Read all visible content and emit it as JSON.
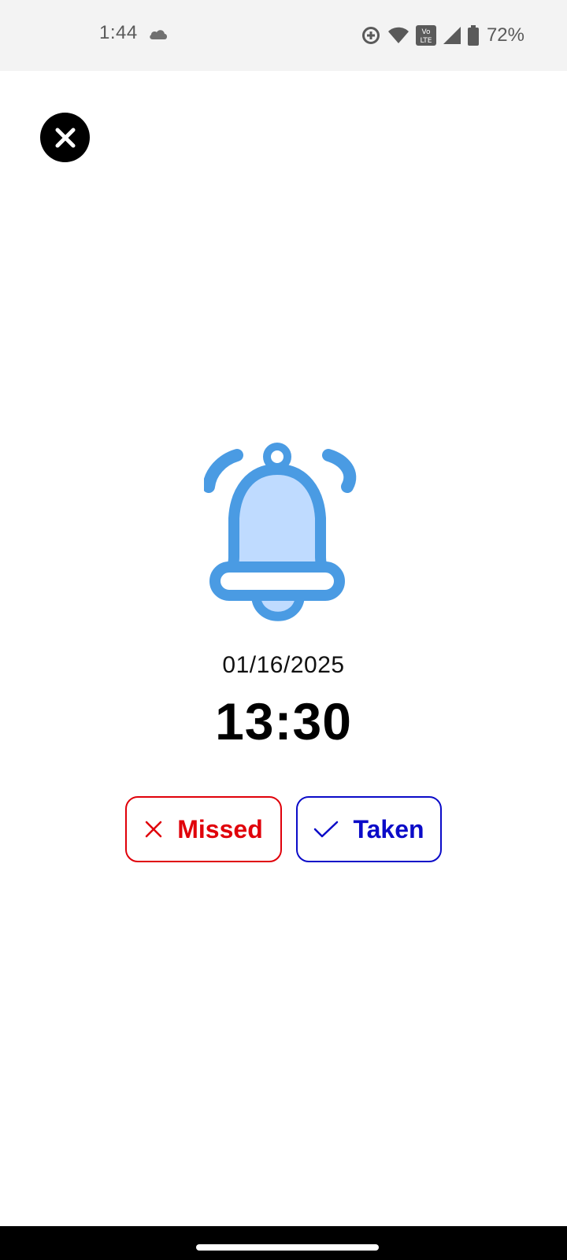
{
  "status_bar": {
    "time": "1:44",
    "battery_percent": "72%",
    "icons": [
      "cloud-icon",
      "data-saver-icon",
      "wifi-icon",
      "volte-icon",
      "signal-icon",
      "battery-icon"
    ],
    "volte_label_top": "Vo",
    "volte_label_bottom": "LTE"
  },
  "close_button": {
    "icon": "close-icon"
  },
  "reminder": {
    "icon": "bell-icon",
    "date": "01/16/2025",
    "time": "13:30"
  },
  "actions": {
    "missed_label": "Missed",
    "taken_label": "Taken"
  },
  "colors": {
    "bell_stroke": "#4A9BE3",
    "bell_fill": "#BFDBFF",
    "missed": "#E0000A",
    "taken": "#0B0BC8"
  }
}
